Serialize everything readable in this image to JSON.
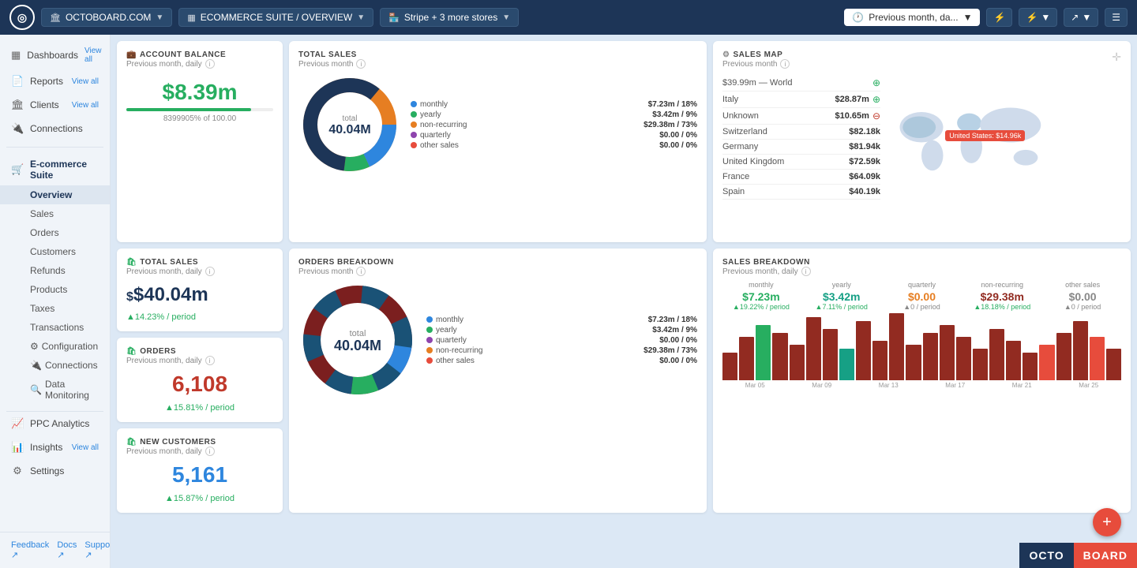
{
  "header": {
    "logo_text": "O",
    "workspace": "OCTOBOARD.COM",
    "suite": "ECOMMERCE SUITE / OVERVIEW",
    "store": "Stripe + 3 more stores",
    "time_range": "Previous month, da...",
    "icon_bolt": "⚡",
    "icon_share": "↗",
    "icon_menu": "☰"
  },
  "sidebar": {
    "dashboards_label": "Dashboards",
    "dashboards_view_all": "View all",
    "reports_label": "Reports",
    "reports_view_all": "View all",
    "clients_label": "Clients",
    "clients_view_all": "View all",
    "connections_label": "Connections",
    "ecommerce_label": "E-commerce Suite",
    "overview_label": "Overview",
    "sales_label": "Sales",
    "orders_label": "Orders",
    "customers_label": "Customers",
    "refunds_label": "Refunds",
    "products_label": "Products",
    "taxes_label": "Taxes",
    "transactions_label": "Transactions",
    "configuration_label": "Configuration",
    "connections_sub_label": "Connections",
    "data_monitoring_label": "Data Monitoring",
    "ppc_label": "PPC Analytics",
    "insights_label": "Insights",
    "insights_view_all": "View all",
    "settings_label": "Settings",
    "feedback_label": "Feedback ↗",
    "docs_label": "Docs ↗",
    "support_label": "Support ↗"
  },
  "account_balance": {
    "title": "ACCOUNT BALANCE",
    "subtitle": "Previous month, daily",
    "value": "$8.39m",
    "meta": "8399905% of 100.00",
    "progress": 85
  },
  "total_sales_small": {
    "title": "TOTAL SALES",
    "subtitle": "Previous month, daily",
    "value": "$40.04m",
    "trend": "▲14.23% / period"
  },
  "total_sales_donut": {
    "title": "TOTAL SALES",
    "subtitle": "Previous month",
    "center_label": "total",
    "center_value": "40.04M",
    "segments": [
      {
        "label": "monthly",
        "color": "#2e86de",
        "value": "$7.23m / 18%"
      },
      {
        "label": "yearly",
        "color": "#27ae60",
        "value": "$3.42m / 9%"
      },
      {
        "label": "non-recurring",
        "color": "#e67e22",
        "value": "$29.38m / 73%"
      },
      {
        "label": "quarterly",
        "color": "#8e44ad",
        "value": "$0.00 / 0%"
      },
      {
        "label": "other sales",
        "color": "#e74c3c",
        "value": "$0.00 / 0%"
      }
    ]
  },
  "sales_map": {
    "title": "SALES MAP",
    "subtitle": "Previous month",
    "world_range": "$39.99m — World",
    "rows": [
      {
        "label": "Italy",
        "value": "$28.87m",
        "action": "+"
      },
      {
        "label": "Unknown",
        "value": "$10.65m",
        "action": "−"
      },
      {
        "label": "Switzerland",
        "value": "$82.18k"
      },
      {
        "label": "Germany",
        "value": "$81.94k"
      },
      {
        "label": "United Kingdom",
        "value": "$72.59k"
      },
      {
        "label": "France",
        "value": "$64.09k"
      },
      {
        "label": "Spain",
        "value": "$40.19k"
      }
    ],
    "us_tooltip": "United States: $14.96k"
  },
  "orders": {
    "title": "ORDERS",
    "subtitle": "Previous month, daily",
    "value": "6,108",
    "trend": "▲15.81% / period"
  },
  "orders_breakdown": {
    "title": "ORDERS BREAKDOWN",
    "subtitle": "Previous month",
    "center_label": "total",
    "center_value": "40.04M",
    "segments": [
      {
        "label": "monthly",
        "color": "#2e86de",
        "value": "$7.23m / 18%"
      },
      {
        "label": "yearly",
        "color": "#27ae60",
        "value": "$3.42m / 9%"
      },
      {
        "label": "quarterly",
        "color": "#8e44ad",
        "value": "$0.00 / 0%"
      },
      {
        "label": "non-recurring",
        "color": "#e67e22",
        "value": "$29.38m / 73%"
      },
      {
        "label": "other sales",
        "color": "#e74c3c",
        "value": "$0.00 / 0%"
      }
    ]
  },
  "new_customers": {
    "title": "NEW CUSTOMERS",
    "subtitle": "Previous month, daily",
    "value": "5,161",
    "trend": "▲15.87% / period"
  },
  "sales_breakdown": {
    "title": "SALES BREAKDOWN",
    "subtitle": "Previous month, daily",
    "cols": [
      {
        "label": "monthly",
        "value": "$7.23m",
        "trend": "▲19.22% / period",
        "color": "green"
      },
      {
        "label": "yearly",
        "value": "$3.42m",
        "trend": "▲7.11% / period",
        "color": "teal"
      },
      {
        "label": "quarterly",
        "value": "$0.00",
        "trend": "▲0 / period",
        "color": "orange"
      },
      {
        "label": "non-recurring",
        "value": "$29.38m",
        "trend": "▲18.18% / period",
        "color": "darkred"
      },
      {
        "label": "other sales",
        "value": "$0.00",
        "trend": "▲0 / period",
        "color": "gray"
      }
    ],
    "x_labels": [
      "Mar 05",
      "Mar 09",
      "Mar 13",
      "Mar 17",
      "Mar 21",
      "Mar 25"
    ],
    "bar_data": [
      35,
      55,
      70,
      60,
      45,
      80,
      65,
      40,
      75,
      50,
      85,
      45,
      60,
      70,
      55,
      40,
      65,
      50,
      35,
      45,
      60,
      75,
      55,
      40
    ]
  },
  "fab_icon": "+",
  "brand": {
    "octo": "OCTO",
    "board": "BOARD"
  }
}
